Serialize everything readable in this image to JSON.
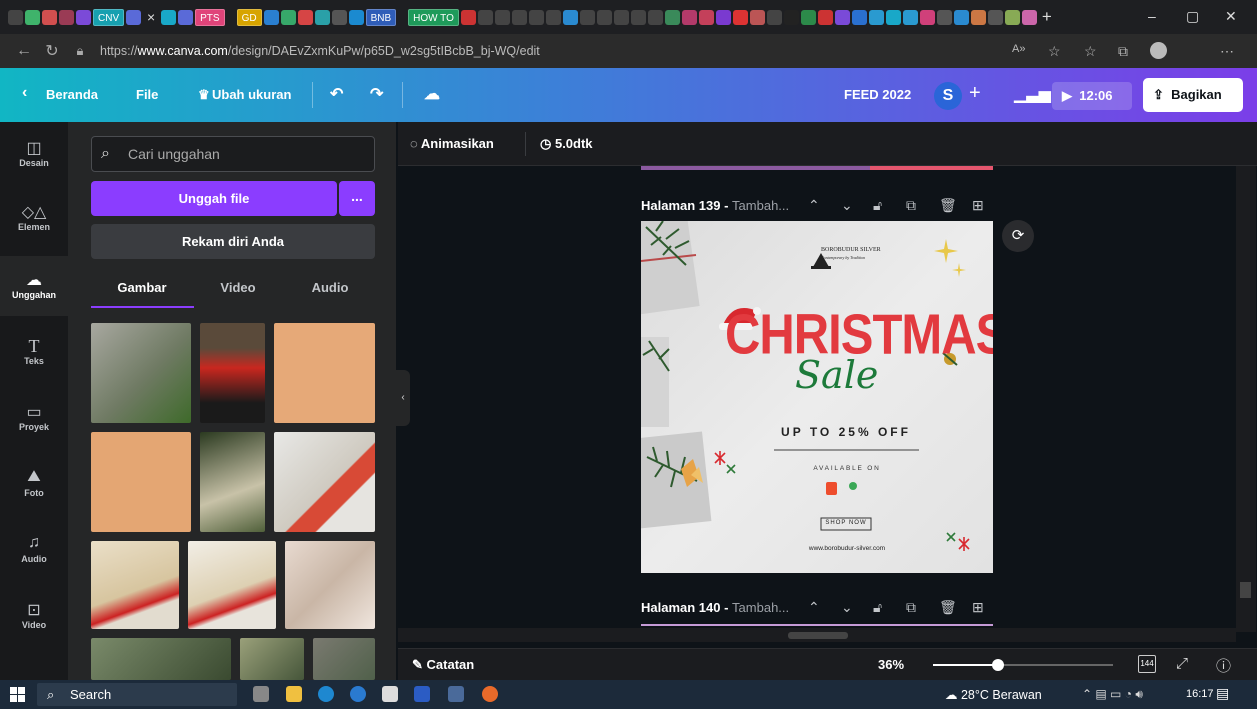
{
  "browser": {
    "tabs": [
      "CNV",
      "PTS",
      "GD",
      "BNB",
      "HOW TO"
    ],
    "address": {
      "scheme": "https://",
      "host": "www.canva.com",
      "path": "/design/DAEvZxmKuPw/p65D_w2sg5tIBcbB_bj-WQ/edit"
    }
  },
  "canva_bar": {
    "home": "Beranda",
    "file": "File",
    "resize": "Ubah ukuran",
    "doc_title": "FEED 2022",
    "avatar_initial": "S",
    "timer": "12:06",
    "share": "Bagikan"
  },
  "rail": [
    {
      "label": "Desain",
      "icon": "layout-icon"
    },
    {
      "label": "Elemen",
      "icon": "shapes-icon"
    },
    {
      "label": "Unggahan",
      "icon": "cloud-upload-icon"
    },
    {
      "label": "Teks",
      "icon": "text-icon"
    },
    {
      "label": "Proyek",
      "icon": "folder-icon"
    },
    {
      "label": "Foto",
      "icon": "photo-icon"
    },
    {
      "label": "Audio",
      "icon": "music-icon"
    },
    {
      "label": "Video",
      "icon": "video-icon"
    }
  ],
  "panel": {
    "search_placeholder": "Cari unggahan",
    "upload_button": "Unggah file",
    "more_button": "...",
    "record_button": "Rekam diri Anda",
    "tabs": [
      "Gambar",
      "Video",
      "Audio"
    ]
  },
  "canvas": {
    "animate": "Animasikan",
    "duration": "5.0dtk",
    "page1_label": "Halaman 139 - ",
    "page1_sub": "Tambah...",
    "page2_label": "Halaman 140 - ",
    "page2_sub": "Tambah...",
    "design": {
      "brand": "BOROBUDUR SILVER",
      "brand_tag": "Contemporary by Tradition",
      "headline": "CHRISTMAS",
      "script": "Sale",
      "offer": "UP TO 25% OFF",
      "available": "AVAILABLE ON",
      "shop_now": "SHOP NOW",
      "website": "www.borobudur-silver.com"
    }
  },
  "bottom": {
    "notes": "Catatan",
    "zoom": "36%",
    "zoom_value": 0.36,
    "page_count": "144"
  },
  "taskbar": {
    "search": "Search",
    "weather": "28°C  Berawan",
    "time": "16:17"
  },
  "colors": {
    "accent": "#8b3dff",
    "headline_red": "#e23a3f",
    "script_green": "#1d7a3a"
  }
}
